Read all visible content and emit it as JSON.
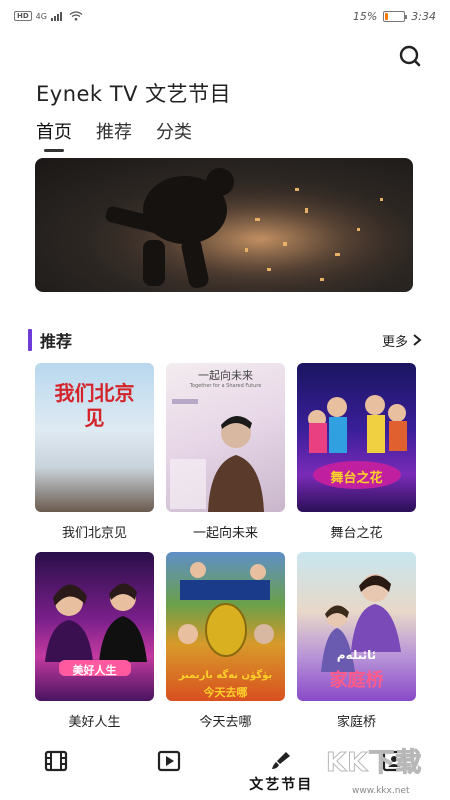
{
  "status_bar": {
    "hd": "HD",
    "network": "4G",
    "battery": "15%",
    "time": "3:34",
    "battery_level": 0.15,
    "battery_color": "#ff7a00"
  },
  "header": {
    "title": "Eynek TV 文艺节目",
    "search_icon": "search-icon"
  },
  "tabs": [
    {
      "label": "首页",
      "active": true
    },
    {
      "label": "推荐",
      "active": false
    },
    {
      "label": "分类",
      "active": false
    }
  ],
  "section": {
    "title": "推荐",
    "more_label": "更多",
    "accent": "#6b3cd8"
  },
  "cards": [
    {
      "label": "我们北京见",
      "poster_text": "我们北京见"
    },
    {
      "label": "一起向未来",
      "poster_text": "一起向未来",
      "poster_sub": "Together for a Shared Future"
    },
    {
      "label": "舞台之花",
      "poster_text": "舞台之花"
    },
    {
      "label": "美好人生",
      "poster_text": "美好人生"
    },
    {
      "label": "今天去哪",
      "poster_text": "بۈگۈن نەگە بارىمىز",
      "poster_sub": "今天去哪"
    },
    {
      "label": "家庭桥",
      "poster_text": "ئائىلەم",
      "poster_sub": "家庭桥"
    }
  ],
  "bottom_nav": [
    {
      "icon": "film-icon",
      "label": ""
    },
    {
      "icon": "play-icon",
      "label": ""
    },
    {
      "icon": "brush-icon",
      "label": "文艺节目"
    },
    {
      "icon": "profile-icon",
      "label": ""
    }
  ],
  "watermark": {
    "text": "KK下载",
    "sub": "www.kkx.net"
  }
}
